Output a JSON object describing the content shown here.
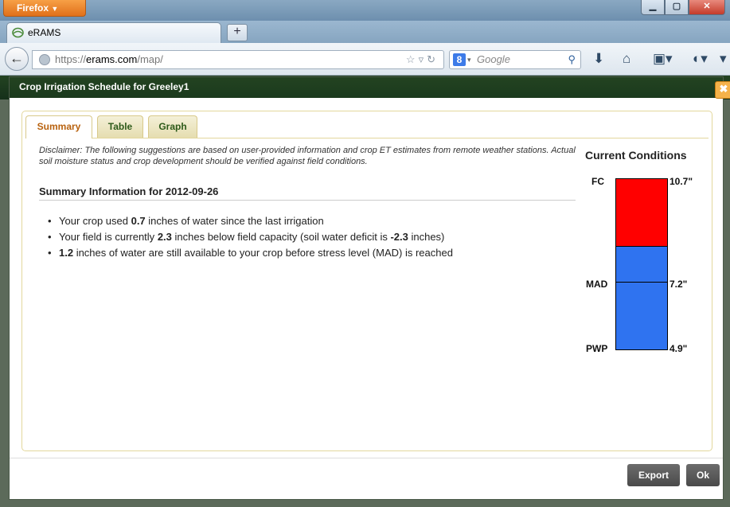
{
  "browser": {
    "firefox_button": "Firefox",
    "tab_title": "eRAMS",
    "url_prefix": "https://",
    "url_host": "erams.com",
    "url_path": "/map/",
    "search_placeholder": "Google"
  },
  "dialog": {
    "title": "Crop Irrigation Schedule for Greeley1",
    "tabs": [
      {
        "label": "Summary",
        "active": true
      },
      {
        "label": "Table",
        "active": false
      },
      {
        "label": "Graph",
        "active": false
      }
    ],
    "disclaimer": "Disclaimer: The following suggestions are based on user-provided information and crop ET estimates from remote weather stations. Actual soil moisture status and crop development should be verified against field conditions.",
    "summary_heading": "Summary Information for 2012-09-26",
    "bullets": [
      {
        "pre": "Your crop used ",
        "value": "0.7",
        "post": " inches of water since the last irrigation"
      },
      {
        "pre": "Your field is currently ",
        "value": "2.3",
        "mid": " inches below field capacity (soil water deficit is ",
        "value2": "-2.3",
        "post": " inches)"
      },
      {
        "pre": "",
        "value": "1.2",
        "post": " inches of water are still available to your crop before stress level (MAD) is reached"
      }
    ],
    "current_conditions": {
      "title": "Current Conditions",
      "fc_label": "FC",
      "fc_value": "10.7\"",
      "mad_label": "MAD",
      "mad_value": "7.2\"",
      "pwp_label": "PWP",
      "pwp_value": "4.9\"",
      "fc": 10.7,
      "current": 8.4,
      "mad": 7.2,
      "pwp": 4.9,
      "deficit_color": "#ff0000",
      "available_color": "#2f73f0"
    },
    "buttons": {
      "export": "Export",
      "ok": "Ok"
    }
  }
}
